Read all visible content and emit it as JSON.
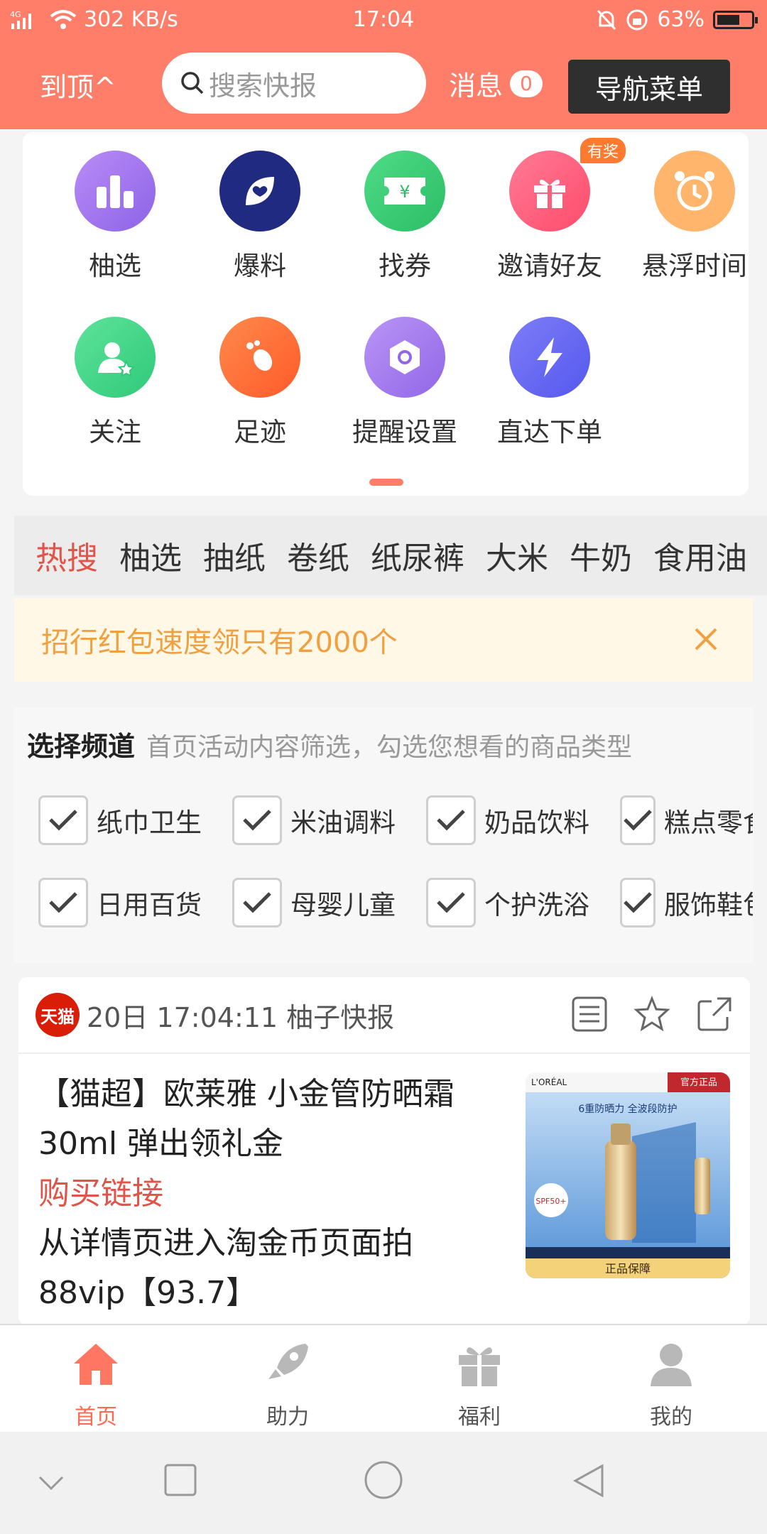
{
  "status": {
    "network": "4G",
    "speed": "302 KB/s",
    "time": "17:04",
    "battery": "63%"
  },
  "header": {
    "to_top": "到顶^",
    "search_placeholder": "搜索快报",
    "messages_label": "消息",
    "messages_count": "0",
    "nav_menu": "导航菜单"
  },
  "quick_grid": [
    {
      "label": "柚选",
      "icon": "bar-chart-icon",
      "color": "#a679f0"
    },
    {
      "label": "爆料",
      "icon": "leaf-heart-icon",
      "color": "#1f2a80"
    },
    {
      "label": "找券",
      "icon": "coupon-icon",
      "color": "#3ccf75"
    },
    {
      "label": "邀请好友",
      "icon": "gift-icon",
      "color": "#ff5f7e",
      "badge": "有奖"
    },
    {
      "label": "悬浮时间",
      "icon": "alarm-clock-icon",
      "color": "#ffb56b"
    },
    {
      "label": "关注",
      "icon": "user-star-icon",
      "color": "#3ed48a"
    },
    {
      "label": "足迹",
      "icon": "footprint-icon",
      "color": "#ff6a3d"
    },
    {
      "label": "提醒设置",
      "icon": "settings-hex-icon",
      "color": "#a87cf0"
    },
    {
      "label": "直达下单",
      "icon": "lightning-icon",
      "color": "#6b6cf5"
    }
  ],
  "hot_search": [
    "热搜",
    "柚选",
    "抽纸",
    "卷纸",
    "纸尿裤",
    "大米",
    "牛奶",
    "食用油"
  ],
  "notice": {
    "text": "招行红包速度领只有2000个"
  },
  "channels": {
    "title": "选择频道",
    "subtitle": "首页活动内容筛选，勾选您想看的商品类型",
    "items": [
      "纸巾卫生",
      "米油调料",
      "奶品饮料",
      "糕点零食",
      "日用百货",
      "母婴儿童",
      "个护洗浴",
      "服饰鞋包"
    ]
  },
  "feed": {
    "source_badge": "天猫",
    "meta": "20日 17:04:11 柚子快报",
    "title": "【猫超】欧莱雅 小金管防晒霜30ml 弹出领礼金",
    "link": "购买链接",
    "desc": "从详情页进入淘金币页面拍88vip【93.7】",
    "image": {
      "brand": "L'ORÉAL",
      "tag": "官方正品",
      "headline": "6重防晒力 全波段防护",
      "spf": "SPF50+",
      "footer": "正品保障"
    }
  },
  "tabs": [
    {
      "label": "首页",
      "icon": "home-icon",
      "active": true
    },
    {
      "label": "助力",
      "icon": "rocket-icon"
    },
    {
      "label": "福利",
      "icon": "gift-box-icon"
    },
    {
      "label": "我的",
      "icon": "person-icon"
    }
  ],
  "colors": {
    "brand": "#ff7e69",
    "accent_red": "#e0544a",
    "notice_text": "#f0a040"
  }
}
